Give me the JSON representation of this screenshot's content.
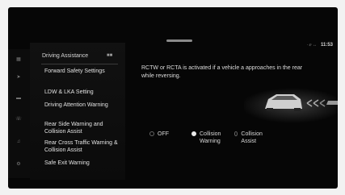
{
  "status": {
    "signal": "· ⅇ ↔",
    "time": "11:53"
  },
  "rail_icons": [
    "grid-icon",
    "navigation-icon",
    "car-icon",
    "phone-icon",
    "media-icon",
    "settings-icon"
  ],
  "menu": {
    "header": "Driving Assistance",
    "items": [
      "Forward Safety Settings",
      "LDW & LKA Setting",
      "Driving Attention Warning",
      "Rear Side Warning and Collision Assist",
      "Rear Cross Traffic Warning & Collision Assist",
      "Safe Exit Warning"
    ]
  },
  "content": {
    "description": "RCTW or RCTA is activated if a vehicle a approaches in the rear while reversing.",
    "options": [
      {
        "label": "OFF",
        "selected": false
      },
      {
        "label": "Collision Warning",
        "selected": true
      },
      {
        "label": "Collision Assist",
        "selected": false
      }
    ]
  }
}
